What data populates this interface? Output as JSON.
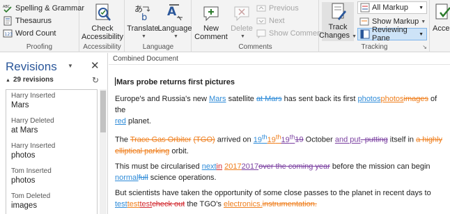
{
  "ribbon": {
    "proofing": {
      "label": "Proofing",
      "spelling": "Spelling & Grammar",
      "thesaurus": "Thesaurus",
      "word_count": "Word Count"
    },
    "accessibility": {
      "label": "Accessibility",
      "check_line1": "Check",
      "check_line2": "Accessibility"
    },
    "language": {
      "label": "Language",
      "translate": "Translate",
      "language": "Language"
    },
    "comments": {
      "label": "Comments",
      "new_line1": "New",
      "new_line2": "Comment",
      "delete": "Delete",
      "previous": "Previous",
      "next": "Next",
      "show_comments": "Show Comments"
    },
    "tracking": {
      "label": "Tracking",
      "track_line1": "Track",
      "track_line2": "Changes",
      "all_markup": "All Markup",
      "show_markup": "Show Markup",
      "reviewing_pane": "Reviewing Pane"
    },
    "changes": {
      "accept_partial": "Acce"
    }
  },
  "pane": {
    "title": "Revisions",
    "count": "29 revisions",
    "items": [
      {
        "meta": "Harry Inserted",
        "text": "Mars"
      },
      {
        "meta": "Harry Deleted",
        "text": "at Mars"
      },
      {
        "meta": "Harry Inserted",
        "text": "photos"
      },
      {
        "meta": "Tom Inserted",
        "text": "photos"
      },
      {
        "meta": "Tom Deleted",
        "text": "images"
      }
    ]
  },
  "document": {
    "header": "Combined Document",
    "title": "Mars probe returns first pictures",
    "p1": {
      "t1": "Europe's and Russia's new ",
      "ins1": "Mars",
      "t2": " satellite ",
      "del1": "at Mars",
      "t3": " has sent back its first ",
      "ins2": "photos",
      "ins3": "photos",
      "del2": "images",
      "t4": " of the",
      "ins4": "red",
      "t5": " planet."
    },
    "p2": {
      "t1": "The ",
      "del1": "Trace Gas Orbiter",
      "t2": " ",
      "del2": "(TGO)",
      "t3": " arrived on ",
      "ins1": "19",
      "sup1": "th",
      "ins2": "19",
      "sup2": "th",
      "ins3": "19",
      "sup3": "th",
      "del3": "19",
      "t4": " October ",
      "ins4": "and put",
      "del4": ", putting",
      "t5": " itself in ",
      "del5": "a highly",
      "del6": "elliptical parking",
      "t6": " orbit."
    },
    "p3": {
      "t1": "This must be circularised ",
      "ins1": "next",
      "ins2": "in",
      "t2": " ",
      "ins3": "2017",
      "ins4": "2017",
      "del1": "over the coming year",
      "t3": " before the mission can begin",
      "ins5": "normal",
      "del2": "full",
      "t4": " science operations."
    },
    "p4": {
      "t1": "But scientists have taken the opportunity of some close passes to the planet in recent days to",
      "ins1": "test",
      "ins2": "test",
      "ins3": "test",
      "del1": "check out",
      "t2": " the TGO's ",
      "ins4": "electronics.",
      "del2": "instrumentation."
    }
  },
  "colors": {
    "accent": "#2b579a",
    "harry": "#2e8bd8",
    "tom": "#ef7e1c",
    "author3": "#7a3fa0",
    "author4": "#d2292f"
  }
}
